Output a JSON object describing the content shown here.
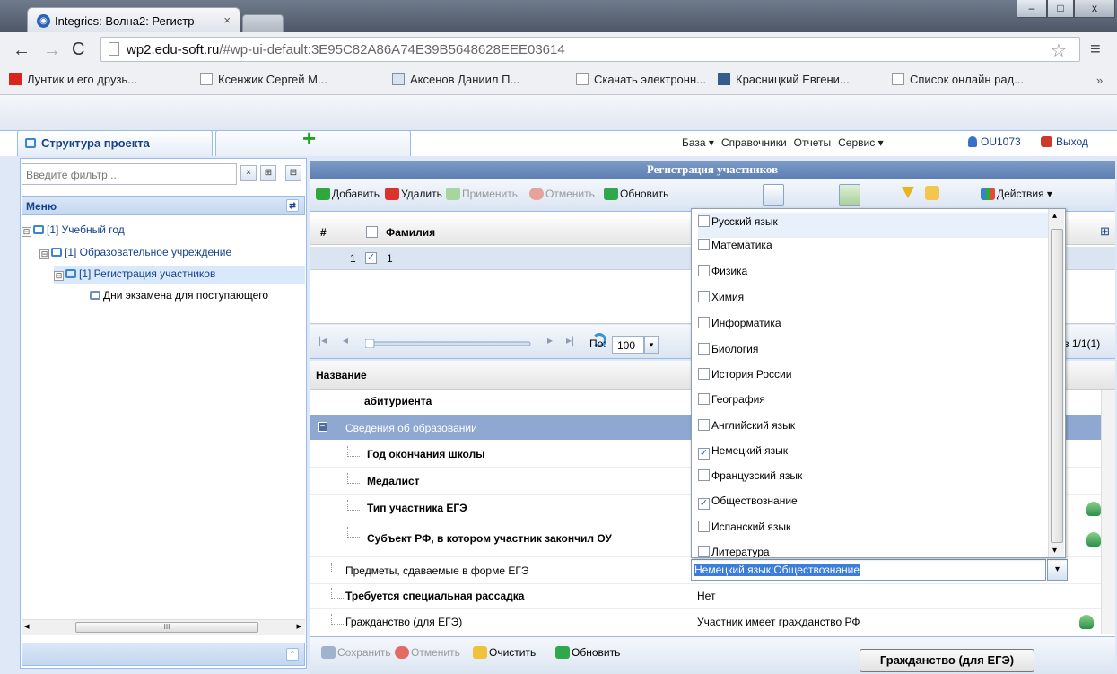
{
  "browser": {
    "tab_title": "Integrics: Волна2: Регистр",
    "tab_close": "×",
    "window_buttons": [
      "–",
      "□",
      "x"
    ],
    "url_host": "wp2.edu-soft.ru",
    "url_path": "/#wp-ui-default:3E95C82A86A74E39B5648628EEE03614",
    "nav_back": "←",
    "nav_forward": "→",
    "nav_reload": "C",
    "star": "☆",
    "menu": "≡",
    "bookmarks": [
      "Лунтик и его друзь...",
      "Ксенжик Сергей М...",
      "Аксенов Даниил П...",
      "Скачать электронн...",
      "Красницкий Евгени...",
      "Список онлайн рад..."
    ],
    "bookmarks_more": "»"
  },
  "app": {
    "project_tab": "Структура проекта",
    "add_tab": "+",
    "top_menu": [
      "База ▾",
      "Справочники",
      "Отчеты",
      "Сервис ▾"
    ],
    "user": "OU1073",
    "exit": "Выход"
  },
  "left": {
    "filter_placeholder": "Введите фильтр...",
    "filter_buttons": [
      "×",
      "⊞",
      "⊟"
    ],
    "menu_title": "Меню",
    "menu_btn": "⇄",
    "tree": [
      {
        "toggle": "⊟",
        "label": "[1] Учебный год"
      },
      {
        "toggle": "⊟",
        "label": "[1] Образовательное учреждение"
      },
      {
        "toggle": "⊟",
        "label": "[1] Регистрация участников"
      },
      {
        "toggle": "",
        "label": "Дни экзамена для поступающего"
      }
    ],
    "scroll_left": "◂",
    "scroll_right": "▸",
    "scroll_thumb": "III",
    "footer_btn": "⌃"
  },
  "main": {
    "title": "Регистрация участников",
    "toolbar": {
      "add": "Добавить",
      "delete": "Удалить",
      "apply": "Применить",
      "cancel": "Отменить",
      "refresh": "Обновить",
      "actions": "Действия ▾"
    },
    "grid": {
      "col_num": "#",
      "col_name": "Фамилия",
      "rows": [
        {
          "num": "1",
          "checked": "✓",
          "name": "1"
        }
      ]
    },
    "pager": {
      "first": "|◂",
      "prev": "◂",
      "next": "▸",
      "last": "▸|",
      "per_page_label": "По:",
      "per_page": "100",
      "dd": "▾",
      "count": "з 1/1(1)"
    },
    "props_header": "Название",
    "props": {
      "partial": "абитуриента",
      "section": "Сведения об образовании",
      "section_toggle": "−",
      "rows": [
        {
          "name": "Год окончания школы",
          "value": ""
        },
        {
          "name": "Медалист",
          "value": ""
        },
        {
          "name": "Тип участника ЕГЭ",
          "value": ""
        },
        {
          "name": "Субъект РФ, в котором участник закончил ОУ",
          "value": ""
        },
        {
          "name": "Предметы, сдаваемые в форме ЕГЭ",
          "value": "Немецкий язык;Обществознание"
        },
        {
          "name": "Требуется специальная рассадка",
          "value": "Нет"
        },
        {
          "name": "Гражданство (для ЕГЭ)",
          "value": "Участник имеет гражданство РФ"
        }
      ]
    },
    "dropdown": {
      "items": [
        {
          "label": "Русский язык",
          "checked": ""
        },
        {
          "label": "Математика",
          "checked": ""
        },
        {
          "label": "Физика",
          "checked": ""
        },
        {
          "label": "Химия",
          "checked": ""
        },
        {
          "label": "Информатика",
          "checked": ""
        },
        {
          "label": "Биология",
          "checked": ""
        },
        {
          "label": "История России",
          "checked": ""
        },
        {
          "label": "География",
          "checked": ""
        },
        {
          "label": "Английский язык",
          "checked": ""
        },
        {
          "label": "Немецкий язык",
          "checked": "✓"
        },
        {
          "label": "Французский язык",
          "checked": ""
        },
        {
          "label": "Обществознание",
          "checked": "✓"
        },
        {
          "label": "Испанский язык",
          "checked": ""
        },
        {
          "label": "Литература",
          "checked": ""
        }
      ],
      "selected_text": "Немецкий язык;Обществознание",
      "arrow": "▾",
      "scroll_up": "▴",
      "scroll_down": "▾"
    },
    "footer": {
      "save": "Сохранить",
      "cancel": "Отменить",
      "clear": "Очистить",
      "refresh": "Обновить"
    },
    "tooltip": "Гражданство (для ЕГЭ)"
  }
}
